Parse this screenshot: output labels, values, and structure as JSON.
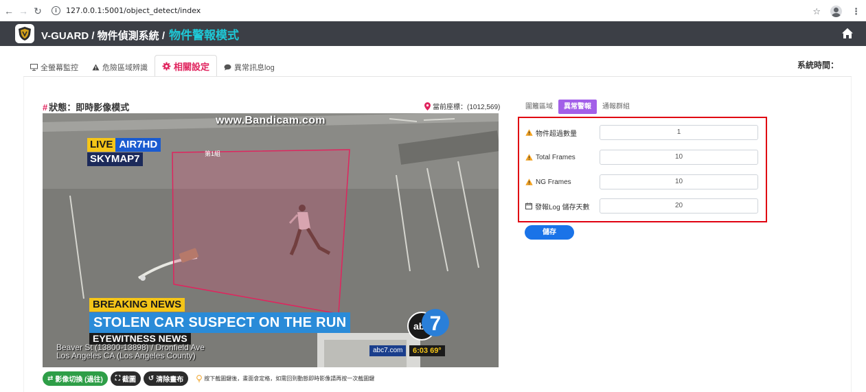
{
  "browser": {
    "url": "127.0.0.1:5001/object_detect/index"
  },
  "app": {
    "brand": "V-GUARD / 物件偵測系統 /",
    "mode": "物件警報模式"
  },
  "tabs": [
    {
      "label": "全螢幕監控",
      "icon": "monitor-icon"
    },
    {
      "label": "危險區域辨識",
      "icon": "warning-icon"
    },
    {
      "label": "相關設定",
      "icon": "gear-icon",
      "active": true
    },
    {
      "label": "異常訊息log",
      "icon": "chat-icon"
    }
  ],
  "system_time_label": "系統時間：",
  "status": {
    "hash": "#",
    "text": "狀態：即時影像模式"
  },
  "coordinate": "當前座標：(1012,569)",
  "video": {
    "watermark": "www.Bandicam.com",
    "roi_label": "第1組",
    "live": "LIVE",
    "channel": "AIR7HD",
    "skymap": "SKYMAP7",
    "breaking": "BREAKING NEWS",
    "headline": "STOLEN CAR SUSPECT ON THE RUN",
    "eyewitness": "EYEWITNESS NEWS",
    "street_line1": "Beaver St (13800-13898) / Dronfield Ave",
    "street_line2": "Los Angeles CA (Los Angeles County)",
    "site": "abc7.com",
    "clock": "6:03  69°"
  },
  "controls": {
    "switch_label": "影像切換 (過往)",
    "capture_label": "截圖",
    "clear_label": "清除畫布",
    "hint": "按下截圖鍵後，畫面會定格，如需回到動態即時影像請再按一次截圖鍵"
  },
  "subtabs": [
    {
      "label": "圍籬區域"
    },
    {
      "label": "異常警報",
      "active": true
    },
    {
      "label": "通報群組"
    }
  ],
  "form": {
    "rows": [
      {
        "label": "物件超過數量",
        "icon": "warning-icon",
        "value": "1"
      },
      {
        "label": "Total Frames",
        "icon": "warning-icon",
        "value": "10"
      },
      {
        "label": "NG Frames",
        "icon": "warning-icon",
        "value": "10"
      },
      {
        "label": "發報Log 儲存天數",
        "icon": "calendar-icon",
        "value": "20"
      }
    ],
    "save_label": "儲存"
  },
  "colors": {
    "header_bg": "#3c3f46",
    "mode_accent": "#1ec8d6",
    "active_tab": "#e0245e",
    "subtab_active": "#a25fe8",
    "highlight_border": "#e00010",
    "save_button": "#1a73e8",
    "switch_button": "#2e9e47"
  }
}
